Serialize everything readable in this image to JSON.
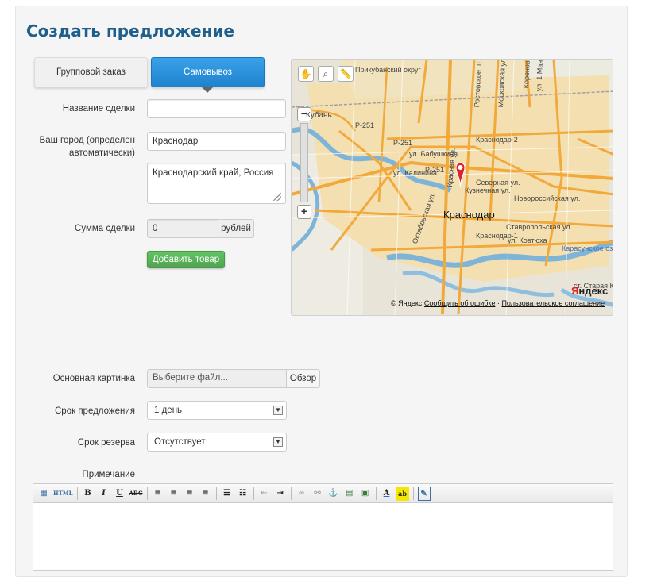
{
  "page": {
    "title": "Создать предложение"
  },
  "tabs": [
    {
      "label": "Групповой заказ",
      "active": false
    },
    {
      "label": "Самовывоз",
      "active": true
    }
  ],
  "form": {
    "deal_name": {
      "label": "Название сделки",
      "value": ""
    },
    "city": {
      "label_line1": "Ваш город (определен",
      "label_line2": "автоматически)",
      "value": "Краснодар",
      "region": "Краснодарский край, Россия"
    },
    "amount": {
      "label": "Сумма сделки",
      "value": "0",
      "unit": "рублей"
    },
    "add_product_button": "Добавить товар",
    "image": {
      "label": "Основная картинка",
      "placeholder": "Выберите файл...",
      "browse": "Обзор"
    },
    "offer_term": {
      "label": "Срок предложения",
      "value": "1 день"
    },
    "reserve_term": {
      "label": "Срок резерва",
      "value": "Отсутствует"
    },
    "note": {
      "label": "Примечание"
    }
  },
  "map": {
    "city_label": "Краснодар",
    "labels": {
      "okrug": "Прикубанский округ",
      "kuban": "Кубань",
      "p251a": "Р-251",
      "p251b": "Р-251",
      "p251c": "Р-251",
      "babushkina": "ул. Бабушкина",
      "kalinina": "ул. Калинина",
      "severnaya": "Северная ул.",
      "kuznechnaya": "Кузнечная ул.",
      "novorossiyskaya": "Новороссийская ул.",
      "stavropolskaya": "Ставропольская ул.",
      "kovtyuha": "ул. Ковтюха",
      "krasnodar2": "Краснодар-2",
      "krasnodar1": "Краснодар-1",
      "karasunskoe": "Карасунское оз.",
      "staraya": "ст. Старая К",
      "oktyabrskaya": "Октябрьская ул.",
      "krasnaya": "Красная ул.",
      "rostovskoe": "Ростовское ш.",
      "moskovskaya": "Московская ул.",
      "ul1maya": "ул. 1 Мая",
      "korenovskaya": "Кореновская"
    },
    "footer_copyright": "© Яндекс",
    "footer_report": "Сообщить об ошибке",
    "footer_terms": "Пользовательское соглашение",
    "logo_y": "Я",
    "logo_rest": "ндекс"
  },
  "editor": {
    "toolbar": [
      "▦",
      "HTML",
      "B",
      "I",
      "U",
      "ABC",
      "≡",
      "≡",
      "≡",
      "≡",
      "☰",
      "☷",
      "⇤",
      "⇥",
      "∞",
      "⚯",
      "⚓",
      "▤",
      "▣",
      "A",
      "ab",
      "✎"
    ]
  },
  "colors": {
    "title": "#1f5f8b",
    "tab_active": "#2a8fdd",
    "button_green": "#5bb75b",
    "map_pin": "#d9232d"
  }
}
